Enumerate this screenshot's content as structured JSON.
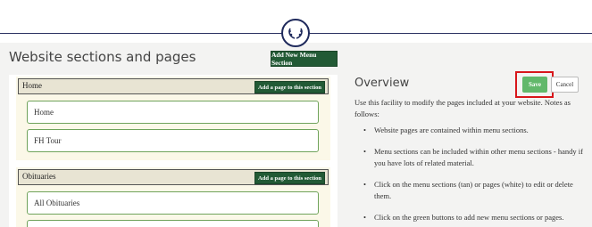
{
  "header": {
    "logo_icon": "wreath-logo-icon"
  },
  "colors": {
    "brand_navy": "#1f2a5c",
    "button_green": "#225a35",
    "save_green": "#62b86b",
    "highlight_red": "#d8161b",
    "section_bg": "#fbf8e8",
    "section_header_bg": "#e8e4d3",
    "page_border": "#6fa35b"
  },
  "main": {
    "title": "Website sections and pages",
    "add_menu_section_label": "Add New Menu Section"
  },
  "sections": [
    {
      "title": "Home",
      "add_page_label": "Add a page to this section",
      "pages": [
        "Home",
        "FH Tour"
      ]
    },
    {
      "title": "Obituaries",
      "add_page_label": "Add a page to this section",
      "pages": [
        "All Obituaries"
      ]
    }
  ],
  "overview": {
    "title": "Overview",
    "save_label": "Save",
    "cancel_label": "Cancel",
    "intro": "Use this facility to modify the pages included at your website. Notes as follows:",
    "notes": [
      "Website pages are contained within menu sections.",
      "Menu sections can be included within other menu sections - handy if you have lots of related material.",
      "Click on the menu sections (tan) or pages (white) to edit or delete them.",
      "Click on the green buttons to add new menu sections or pages."
    ]
  }
}
